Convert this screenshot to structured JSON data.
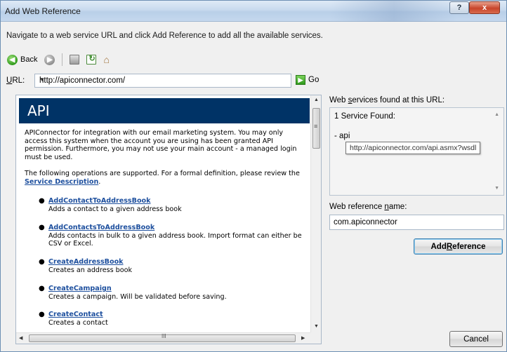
{
  "window": {
    "title": "Add Web Reference",
    "help_label": "?",
    "close_label": "x"
  },
  "instructions": "Navigate to a web service URL and click Add Reference to add all the available services.",
  "toolbar": {
    "back_label": "Back"
  },
  "url": {
    "label_underlined": "U",
    "label_rest": "RL:",
    "value": "http://apiconnector.com/",
    "go_label": "Go"
  },
  "page": {
    "banner": "API",
    "description": "APIConnector for integration with our email marketing system. You may only access this system when the account you are using has been granted API permission. Furthermore, you may not use your main account - a managed login must be used.",
    "ops_intro_prefix": "The following operations are supported. For a formal definition, please review the",
    "service_description_link": "Service Description",
    "ops_intro_suffix": ".",
    "operations": [
      {
        "name": "AddContactToAddressBook",
        "desc": "Adds a contact to a given address book"
      },
      {
        "name": "AddContactsToAddressBook",
        "desc": "Adds contacts in bulk to a given address book. Import format can either be CSV or Excel."
      },
      {
        "name": "CreateAddressBook",
        "desc": "Creates an address book"
      },
      {
        "name": "CreateCampaign",
        "desc": "Creates a campaign. Will be validated before saving."
      },
      {
        "name": "CreateContact",
        "desc": "Creates a contact"
      }
    ],
    "hscroll_grip": "III"
  },
  "services": {
    "label_pre": "Web ",
    "label_underlined": "s",
    "label_post": "ervices found at this URL:",
    "count_text": "1 Service Found:",
    "service_item": "- api",
    "tooltip": "http://apiconnector.com/api.asmx?wsdl"
  },
  "reference": {
    "label_pre": "Web reference ",
    "label_underlined": "n",
    "label_post": "ame:",
    "value": "com.apiconnector"
  },
  "buttons": {
    "add_pre": "Add ",
    "add_underlined": "R",
    "add_post": "eference",
    "cancel": "Cancel"
  },
  "colors": {
    "banner": "#003366",
    "link": "#1d4f9e",
    "title_bar": "#c8daee"
  }
}
